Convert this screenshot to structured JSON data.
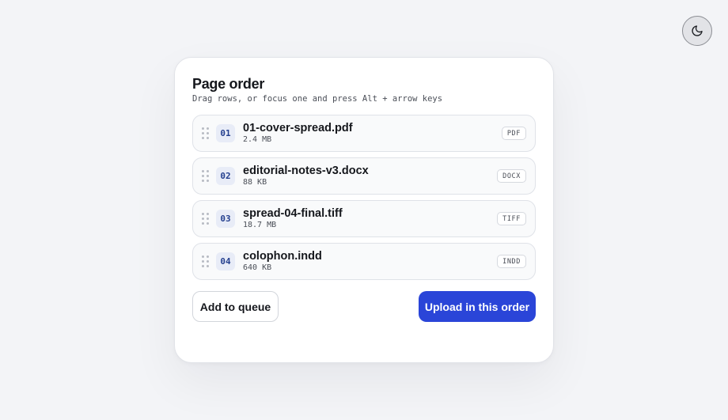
{
  "theme_toggle": {
    "icon": "moon-icon"
  },
  "panel": {
    "title": "Page order",
    "subtitle": "Drag rows, or focus one and press Alt + arrow keys"
  },
  "files": [
    {
      "index": "01",
      "name": "01-cover-spread.pdf",
      "size": "2.4 MB",
      "type": "PDF"
    },
    {
      "index": "02",
      "name": "editorial-notes-v3.docx",
      "size": "88 KB",
      "type": "DOCX"
    },
    {
      "index": "03",
      "name": "spread-04-final.tiff",
      "size": "18.7 MB",
      "type": "TIFF"
    },
    {
      "index": "04",
      "name": "colophon.indd",
      "size": "640 KB",
      "type": "INDD"
    }
  ],
  "actions": {
    "secondary_label": "Add to queue",
    "primary_label": "Upload in this order"
  },
  "colors": {
    "accent": "#2a45d8",
    "background": "#f3f4f7",
    "index_badge_text": "#25408f"
  }
}
